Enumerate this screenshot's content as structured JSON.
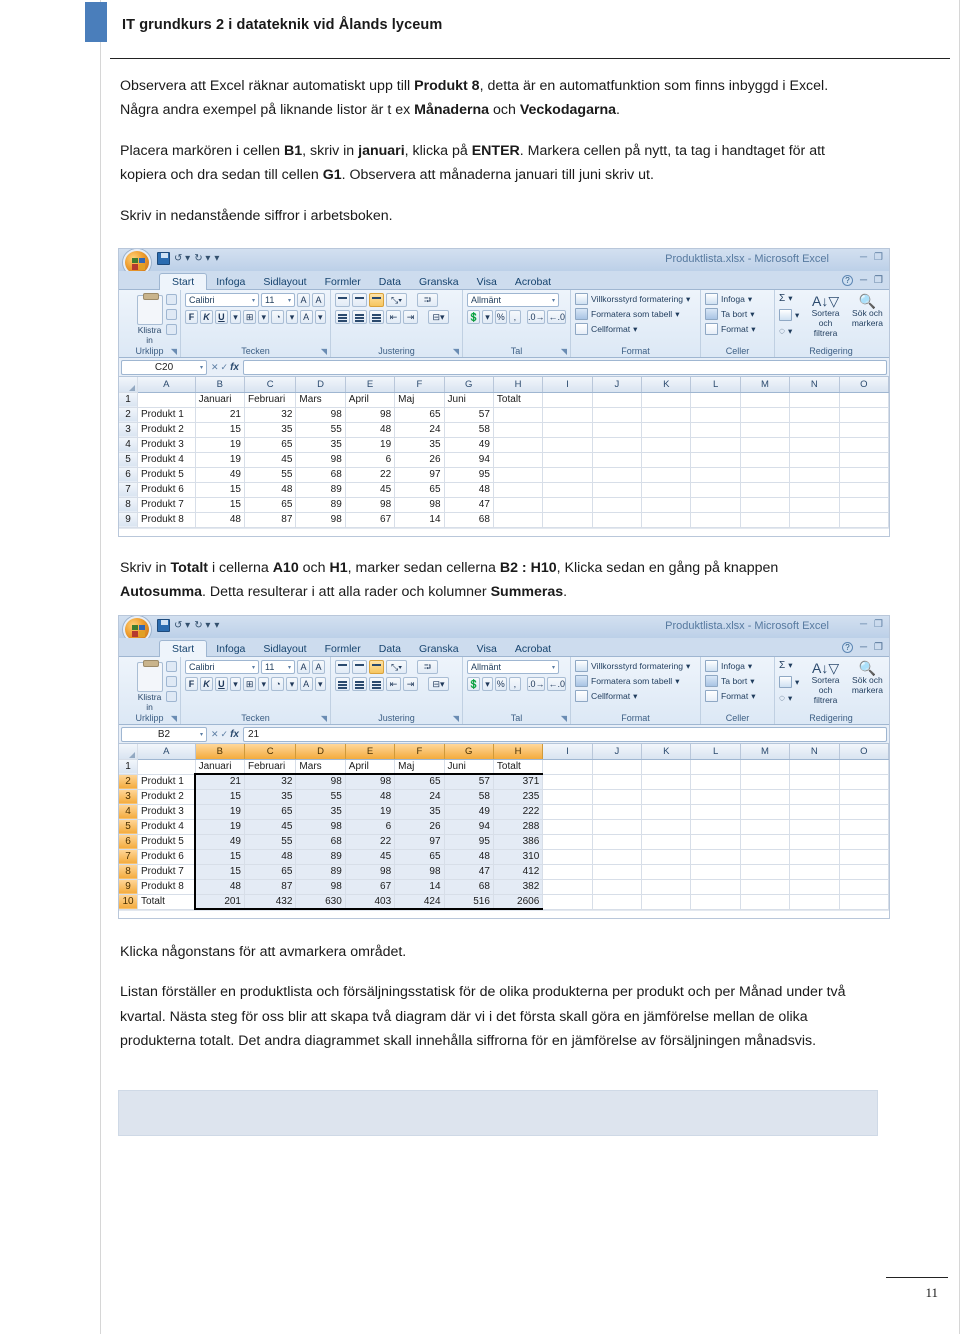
{
  "document": {
    "header_title": "IT grundkurs 2 i datateknik vid Ålands lyceum",
    "page_number": "11",
    "accent_color": "#4a7ebb",
    "paragraphs": [
      {
        "id": "p1",
        "runs": [
          {
            "t": "Observera att Excel räknar automatiskt upp till ",
            "b": false
          },
          {
            "t": "Produkt 8",
            "b": true
          },
          {
            "t": ", detta är en automatfunktion som finns inbyggd i Excel. Några andra exempel på liknande listor är t ex ",
            "b": false
          },
          {
            "t": "Månaderna",
            "b": true
          },
          {
            "t": " och ",
            "b": false
          },
          {
            "t": "Veckodagarna",
            "b": true
          },
          {
            "t": ".",
            "b": false
          }
        ]
      },
      {
        "id": "p2",
        "runs": [
          {
            "t": "Placera markören i cellen ",
            "b": false
          },
          {
            "t": "B1",
            "b": true
          },
          {
            "t": ", skriv in ",
            "b": false
          },
          {
            "t": "januari",
            "b": true
          },
          {
            "t": ", klicka på ",
            "b": false
          },
          {
            "t": "ENTER",
            "b": true
          },
          {
            "t": ". Markera cellen på nytt, ta tag i handtaget för att kopiera och dra sedan till cellen ",
            "b": false
          },
          {
            "t": "G1",
            "b": true
          },
          {
            "t": ". Observera att månaderna januari till juni skriv ut.",
            "b": false
          }
        ]
      },
      {
        "id": "p3",
        "runs": [
          {
            "t": "Skriv in nedanstående siffror i arbetsboken.",
            "b": false
          }
        ]
      },
      {
        "id": "p4",
        "runs": [
          {
            "t": "Skriv in ",
            "b": false
          },
          {
            "t": "Totalt",
            "b": true
          },
          {
            "t": " i cellerna ",
            "b": false
          },
          {
            "t": "A10",
            "b": true
          },
          {
            "t": " och ",
            "b": false
          },
          {
            "t": "H1",
            "b": true
          },
          {
            "t": ", marker sedan cellerna ",
            "b": false
          },
          {
            "t": "B2 : H10",
            "b": true
          },
          {
            "t": ", Klicka sedan en gång på knappen ",
            "b": false
          },
          {
            "t": "Autosumma",
            "b": true
          },
          {
            "t": ". Detta resulterar i att alla rader och kolumner ",
            "b": false
          },
          {
            "t": "Summeras",
            "b": true
          },
          {
            "t": ".",
            "b": false
          }
        ]
      },
      {
        "id": "p5",
        "runs": [
          {
            "t": "Klicka någonstans för att avmarkera området.",
            "b": false
          }
        ]
      },
      {
        "id": "p6",
        "runs": [
          {
            "t": "Listan förställer en produktlista och försäljningsstatisk för de olika produkterna per produkt och per Månad under två kvartal. Nästa steg för oss blir att skapa två diagram där vi i det första skall göra en jämförelse mellan de olika produkterna totalt. Det andra diagrammet skall innehålla siffrorna för en jämförelse av försäljningen månadsvis.",
            "b": false
          }
        ]
      }
    ]
  },
  "excel_common": {
    "window_title": "Produktlista.xlsx - Microsoft Excel",
    "window_title_short": "Produktlista.xlsx -",
    "tabs": [
      "Start",
      "Infoga",
      "Sidlayout",
      "Formler",
      "Data",
      "Granska",
      "Visa",
      "Acrobat"
    ],
    "active_tab": "Start",
    "quick_access": [
      "save-icon",
      "undo-icon",
      "redo-icon",
      "customize-icon"
    ],
    "window_controls": [
      "minimize",
      "restore"
    ],
    "ribbon_groups": [
      {
        "name": "Urklipp",
        "label": "Urklipp"
      },
      {
        "name": "Tecken",
        "label": "Tecken"
      },
      {
        "name": "Justering",
        "label": "Justering"
      },
      {
        "name": "Tal",
        "label": "Tal"
      },
      {
        "name": "Format",
        "label": "Format"
      },
      {
        "name": "Celler",
        "label": "Celler"
      },
      {
        "name": "Redigering",
        "label": "Redigering"
      }
    ],
    "clipboard": {
      "paste_label": "Klistra",
      "paste_label2": "in"
    },
    "font": {
      "family": "Calibri",
      "size": "11",
      "bold": "F",
      "italic": "K",
      "underline": "U"
    },
    "number": {
      "format": "Allmänt",
      "percent": "%",
      "comma": ","
    },
    "styles": [
      "Villkorsstyrd formatering",
      "Formatera som tabell",
      "Cellformat"
    ],
    "cells": [
      "Infoga",
      "Ta bort",
      "Format"
    ],
    "editing": {
      "autosum": "Σ",
      "sort_label": "Sortera och",
      "sort_label2": "filtrera",
      "find_label": "Sök och",
      "find_label2": "markera"
    },
    "columns": [
      "A",
      "B",
      "C",
      "D",
      "E",
      "F",
      "G",
      "H",
      "I",
      "J",
      "K",
      "L",
      "M",
      "N",
      "O"
    ],
    "month_headers": [
      "Januari",
      "Februari",
      "Mars",
      "April",
      "Maj",
      "Juni"
    ],
    "total_header": "Totalt",
    "total_row_label": "Totalt",
    "products": [
      "Produkt 1",
      "Produkt 2",
      "Produkt 3",
      "Produkt 4",
      "Produkt 5",
      "Produkt 6",
      "Produkt 7",
      "Produkt 8"
    ]
  },
  "excel_shot_1": {
    "name_box": "C20",
    "formula_value": "",
    "rows": [
      {
        "row": "1",
        "label": "",
        "values": [
          "Januari",
          "Februari",
          "Mars",
          "April",
          "Maj",
          "Juni"
        ],
        "total": "Totalt",
        "header": true
      },
      {
        "row": "2",
        "label": "Produkt 1",
        "values": [
          "21",
          "32",
          "98",
          "98",
          "65",
          "57"
        ],
        "total": ""
      },
      {
        "row": "3",
        "label": "Produkt 2",
        "values": [
          "15",
          "35",
          "55",
          "48",
          "24",
          "58"
        ],
        "total": ""
      },
      {
        "row": "4",
        "label": "Produkt 3",
        "values": [
          "19",
          "65",
          "35",
          "19",
          "35",
          "49"
        ],
        "total": ""
      },
      {
        "row": "5",
        "label": "Produkt 4",
        "values": [
          "19",
          "45",
          "98",
          "6",
          "26",
          "94"
        ],
        "total": ""
      },
      {
        "row": "6",
        "label": "Produkt 5",
        "values": [
          "49",
          "55",
          "68",
          "22",
          "97",
          "95"
        ],
        "total": ""
      },
      {
        "row": "7",
        "label": "Produkt 6",
        "values": [
          "15",
          "48",
          "89",
          "45",
          "65",
          "48"
        ],
        "total": ""
      },
      {
        "row": "8",
        "label": "Produkt 7",
        "values": [
          "15",
          "65",
          "89",
          "98",
          "98",
          "47"
        ],
        "total": ""
      },
      {
        "row": "9",
        "label": "Produkt 8",
        "values": [
          "48",
          "87",
          "98",
          "67",
          "14",
          "68"
        ],
        "total": ""
      }
    ]
  },
  "excel_shot_2": {
    "name_box": "B2",
    "formula_value": "21",
    "selection_range": "B2:H10",
    "rows": [
      {
        "row": "1",
        "label": "",
        "values": [
          "Januari",
          "Februari",
          "Mars",
          "April",
          "Maj",
          "Juni"
        ],
        "total": "Totalt",
        "header": true
      },
      {
        "row": "2",
        "label": "Produkt 1",
        "values": [
          "21",
          "32",
          "98",
          "98",
          "65",
          "57"
        ],
        "total": "371"
      },
      {
        "row": "3",
        "label": "Produkt 2",
        "values": [
          "15",
          "35",
          "55",
          "48",
          "24",
          "58"
        ],
        "total": "235"
      },
      {
        "row": "4",
        "label": "Produkt 3",
        "values": [
          "19",
          "65",
          "35",
          "19",
          "35",
          "49"
        ],
        "total": "222"
      },
      {
        "row": "5",
        "label": "Produkt 4",
        "values": [
          "19",
          "45",
          "98",
          "6",
          "26",
          "94"
        ],
        "total": "288"
      },
      {
        "row": "6",
        "label": "Produkt 5",
        "values": [
          "49",
          "55",
          "68",
          "22",
          "97",
          "95"
        ],
        "total": "386"
      },
      {
        "row": "7",
        "label": "Produkt 6",
        "values": [
          "15",
          "48",
          "89",
          "45",
          "65",
          "48"
        ],
        "total": "310"
      },
      {
        "row": "8",
        "label": "Produkt 7",
        "values": [
          "15",
          "65",
          "89",
          "98",
          "98",
          "47"
        ],
        "total": "412"
      },
      {
        "row": "9",
        "label": "Produkt 8",
        "values": [
          "48",
          "87",
          "98",
          "67",
          "14",
          "68"
        ],
        "total": "382"
      },
      {
        "row": "10",
        "label": "Totalt",
        "values": [
          "201",
          "432",
          "630",
          "403",
          "424",
          "516"
        ],
        "total": "2606"
      }
    ]
  }
}
